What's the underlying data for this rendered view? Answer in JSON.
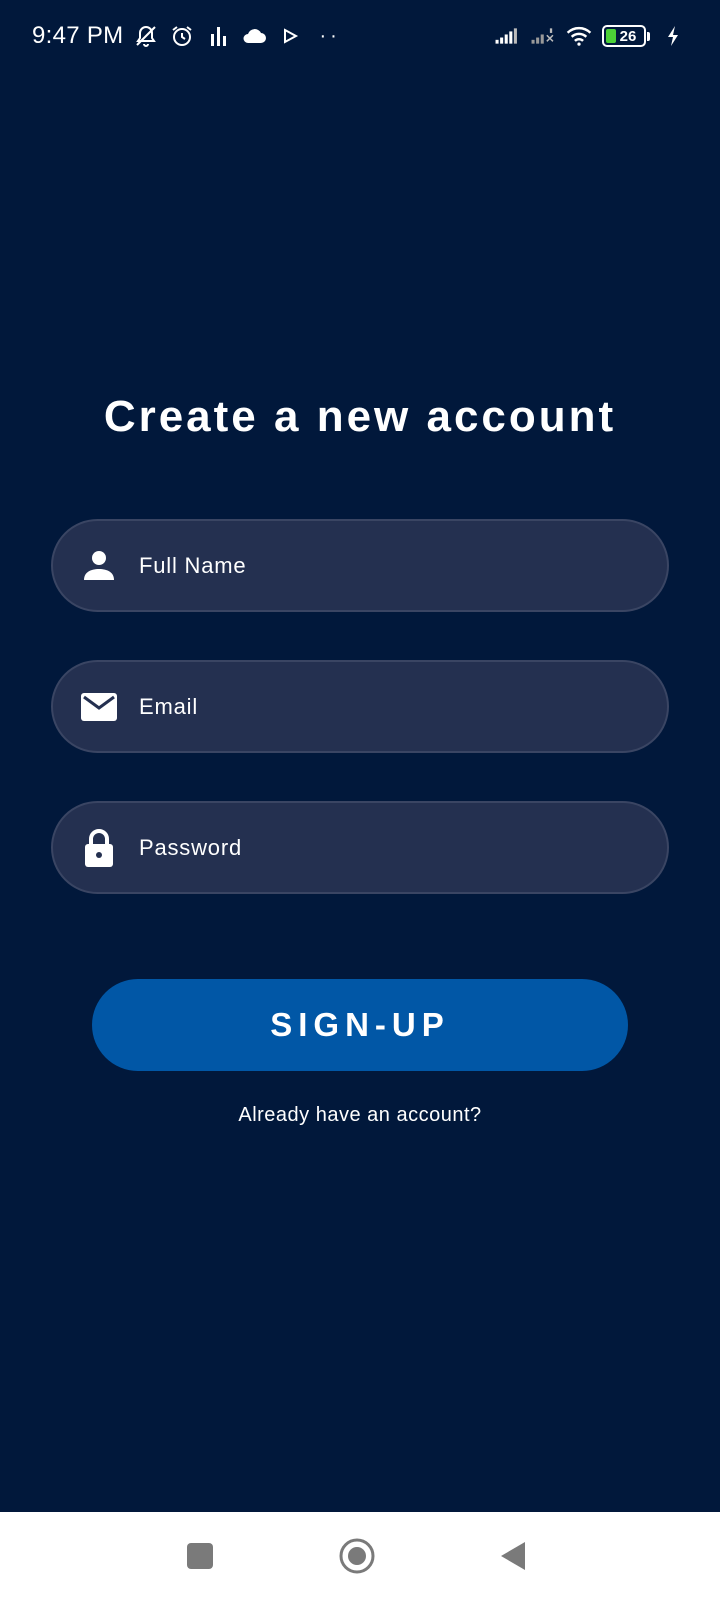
{
  "status_bar": {
    "time": "9:47 PM",
    "battery_level": "26",
    "icons": [
      "muted-bell-icon",
      "alarm-icon",
      "equalizer-icon",
      "cloud-icon",
      "play-icon",
      "more-dots-icon",
      "signal-icon",
      "signal-no-service-icon",
      "wifi-icon",
      "battery-icon",
      "charging-icon"
    ]
  },
  "signup": {
    "title": "Create a new account",
    "fields": {
      "full_name": {
        "placeholder": "Full Name",
        "value": ""
      },
      "email": {
        "placeholder": "Email",
        "value": ""
      },
      "password": {
        "placeholder": "Password",
        "value": ""
      }
    },
    "button_label": "SIGN-UP",
    "login_link": "Already have an account?"
  },
  "colors": {
    "background": "#01183b",
    "field_background": "#243050",
    "button": "#0157a6",
    "battery_fill": "#4cd137"
  },
  "nav_bar": {
    "buttons": [
      "recents-icon",
      "home-icon",
      "back-icon"
    ]
  }
}
